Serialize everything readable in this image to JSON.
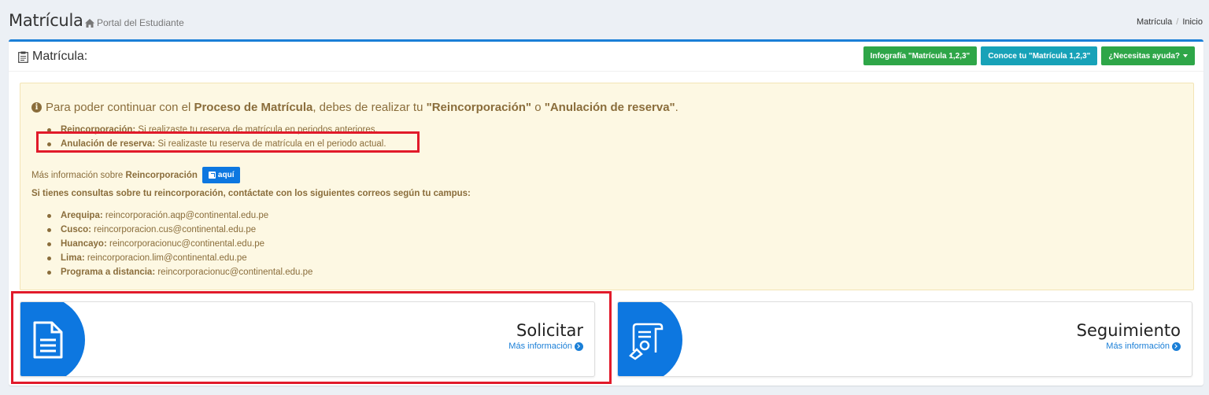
{
  "header": {
    "title": "Matrícula",
    "subtitle": "Portal del Estudiante",
    "breadcrumb": [
      "Matrícula",
      "Inicio"
    ]
  },
  "box": {
    "title": "Matrícula:",
    "buttons": [
      "Infografía \"Matrícula 1,2,3\"",
      "Conoce tu \"Matrícula 1,2,3\"",
      "¿Necesitas ayuda?"
    ]
  },
  "alert": {
    "headline": {
      "t1": "Para poder continuar con el ",
      "b1": "Proceso de Matrícula",
      "t2": ", debes de realizar tu ",
      "b2": "\"Reincorporación\"",
      "t3": " o ",
      "b3": "\"Anulación de reserva\"",
      "t4": "."
    },
    "items": [
      {
        "label": "Reincorporación:",
        "text": " Si realizaste tu reserva de matrícula en periodos anteriores."
      },
      {
        "label": "Anulación de reserva:",
        "text": " Si realizaste tu reserva de matrícula en el periodo actual."
      }
    ],
    "moreinfo_text": "Más información sobre ",
    "moreinfo_bold": "Reincorporación",
    "aqui_label": "aquí",
    "consult": "Si tienes consultas sobre tu reincorporación, contáctate con los siguientes correos según tu campus:",
    "campus": [
      {
        "label": "Arequipa:",
        "email": " reincorporación.aqp@continental.edu.pe"
      },
      {
        "label": "Cusco:",
        "email": " reincorporacion.cus@continental.edu.pe"
      },
      {
        "label": "Huancayo:",
        "email": " reincorporacionuc@continental.edu.pe"
      },
      {
        "label": "Lima:",
        "email": " reincorporacion.lim@continental.edu.pe"
      },
      {
        "label": "Programa a distancia:",
        "email": " reincorporacionuc@continental.edu.pe"
      }
    ]
  },
  "cards": [
    {
      "title": "Solicitar",
      "link": "Más información"
    },
    {
      "title": "Seguimiento",
      "link": "Más información"
    }
  ],
  "colors": {
    "primary": "#0d77e0",
    "green": "#2ea648",
    "teal": "#17a2b8",
    "highlight": "#e11a2a"
  }
}
